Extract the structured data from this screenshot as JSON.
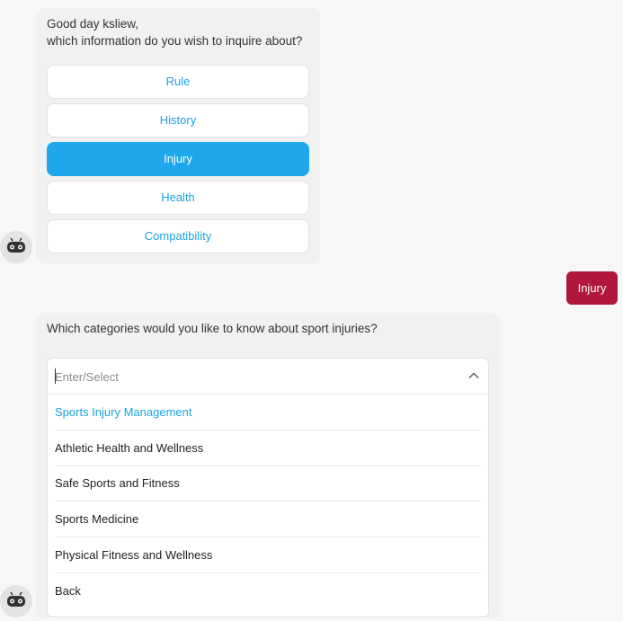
{
  "bot": {
    "greeting_line1": "Good day ksliew,",
    "greeting_line2": "which information do you wish to inquire about?",
    "options": [
      "Rule",
      "History",
      "Injury",
      "Health",
      "Compatibility"
    ],
    "active_option": "Injury",
    "avatar_icon": "robot-icon"
  },
  "user": {
    "reply": "Injury"
  },
  "bot2": {
    "question": "Which categories would you like to know about sport injuries?",
    "select": {
      "placeholder": "Enter/Select",
      "options": [
        "Sports Injury Management",
        "Athletic Health and Wellness",
        "Safe Sports and Fitness",
        "Sports Medicine",
        "Physical Fitness and Wellness",
        "Back"
      ],
      "highlighted": "Sports Injury Management"
    }
  },
  "colors": {
    "accent": "#1ea7ec",
    "link": "#1ba3e0",
    "user_bubble": "#b0173b"
  }
}
